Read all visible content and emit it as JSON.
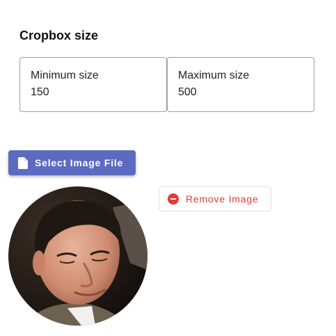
{
  "cropbox": {
    "title": "Cropbox size",
    "minimum": {
      "label": "Minimum size",
      "value": "150"
    },
    "maximum": {
      "label": "Maximum size",
      "value": "500"
    }
  },
  "actions": {
    "select_label": "Select Image File",
    "select_icon": "file-icon",
    "remove_label": "Remove Image",
    "remove_icon": "remove-circle-icon"
  },
  "preview": {
    "shape": "circle"
  },
  "colors": {
    "primary": "#5c6bc0",
    "danger": "#e53935"
  }
}
